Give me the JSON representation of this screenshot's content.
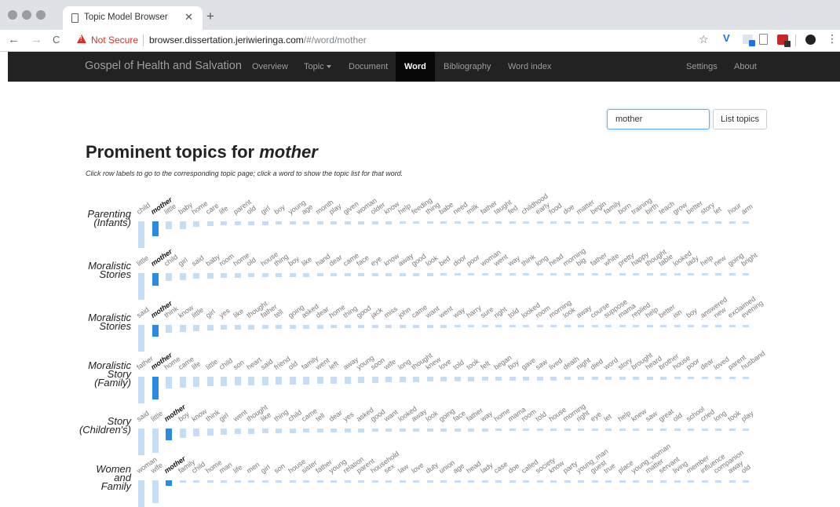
{
  "browser": {
    "tab_title": "Topic Model Browser",
    "close_glyph": "✕",
    "newtab_glyph": "+",
    "back_glyph": "←",
    "forward_glyph": "→",
    "reload_glyph": "C",
    "security_label": "Not Secure",
    "url_host": "browser.dissertation.jeriwieringa.com",
    "url_path": "/#/word/mother",
    "star_glyph": "☆",
    "menu_glyph": "⋮"
  },
  "navbar": {
    "brand": "Gospel of Health and Salvation",
    "items": [
      "Overview",
      "Topic",
      "Document",
      "Word",
      "Bibliography",
      "Word index"
    ],
    "active": "Word",
    "right_items": [
      "Settings",
      "About"
    ]
  },
  "search": {
    "value": "mother",
    "button_label": "List topics"
  },
  "heading": {
    "prefix": "Prominent topics for ",
    "word": "mother"
  },
  "help_text": "Click row labels to go to the corresponding topic page; click a word to show the topic list for that word.",
  "colors": {
    "navbar_bg": "#222222",
    "bar_highlight": "#2b8ae2",
    "bar_normal": "#c6def5"
  },
  "highlight_word": "mother",
  "rows": [
    {
      "label_lines": [
        "Parenting",
        "(Infants)"
      ],
      "words": [
        "child",
        "mother",
        "little",
        "baby",
        "home",
        "care",
        "life",
        "parent",
        "old",
        "girl",
        "boy",
        "young",
        "age",
        "month",
        "play",
        "given",
        "woman",
        "older",
        "know",
        "help",
        "feeding",
        "thing",
        "babe",
        "need",
        "milk",
        "father",
        "taught",
        "fed",
        "childhood",
        "early",
        "food",
        "doe",
        "matter",
        "begin",
        "family",
        "born",
        "training",
        "birth",
        "teach",
        "grow",
        "better",
        "story",
        "let",
        "hour",
        "arm"
      ],
      "weights": [
        1.0,
        0.55,
        0.3,
        0.28,
        0.2,
        0.17,
        0.16,
        0.15,
        0.14,
        0.14,
        0.13,
        0.13,
        0.12,
        0.12,
        0.12,
        0.11,
        0.11,
        0.11,
        0.11,
        0.1,
        0.1,
        0.1,
        0.1,
        0.1,
        0.1,
        0.1,
        0.1,
        0.1,
        0.1,
        0.1,
        0.1,
        0.1,
        0.1,
        0.1,
        0.1,
        0.1,
        0.1,
        0.1,
        0.1,
        0.1,
        0.1,
        0.1,
        0.1,
        0.1,
        0.1
      ]
    },
    {
      "label_lines": [
        "Moralistic",
        "Stories"
      ],
      "words": [
        "little",
        "mother",
        "child",
        "girl",
        "said",
        "baby",
        "room",
        "home",
        "old",
        "house",
        "thing",
        "boy",
        "like",
        "hand",
        "dear",
        "came",
        "face",
        "eye",
        "know",
        "away",
        "good",
        "look",
        "bed",
        "door",
        "poor",
        "woman",
        "went",
        "way",
        "think",
        "long",
        "head",
        "morning",
        "big",
        "father",
        "white",
        "pretty",
        "happy",
        "thought",
        "table",
        "looked",
        "lady",
        "help",
        "new",
        "going",
        "bright"
      ],
      "weights": [
        1.0,
        0.48,
        0.3,
        0.25,
        0.22,
        0.2,
        0.18,
        0.17,
        0.16,
        0.15,
        0.15,
        0.14,
        0.14,
        0.13,
        0.13,
        0.12,
        0.12,
        0.12,
        0.11,
        0.11,
        0.11,
        0.11,
        0.1,
        0.1,
        0.1,
        0.1,
        0.1,
        0.1,
        0.1,
        0.1,
        0.1,
        0.1,
        0.1,
        0.1,
        0.1,
        0.1,
        0.1,
        0.1,
        0.1,
        0.1,
        0.1,
        0.1,
        0.1,
        0.1,
        0.1
      ]
    },
    {
      "label_lines": [
        "Moralistic",
        "Stories"
      ],
      "words": [
        "said",
        "mother",
        "think",
        "know",
        "little",
        "girl",
        "yes",
        "like",
        "thought",
        "father",
        "tell",
        "going",
        "asked",
        "dear",
        "home",
        "thing",
        "good",
        "jack",
        "miss",
        "john",
        "came",
        "want",
        "went",
        "way",
        "harry",
        "sure",
        "right",
        "told",
        "looked",
        "room",
        "morning",
        "look",
        "away",
        "course",
        "suppose",
        "mama",
        "replied",
        "help",
        "better",
        "isn",
        "boy",
        "answered",
        "new",
        "exclaimed",
        "evening"
      ],
      "weights": [
        1.0,
        0.45,
        0.3,
        0.26,
        0.23,
        0.21,
        0.19,
        0.18,
        0.17,
        0.16,
        0.15,
        0.15,
        0.14,
        0.14,
        0.13,
        0.13,
        0.12,
        0.12,
        0.12,
        0.11,
        0.11,
        0.11,
        0.11,
        0.1,
        0.1,
        0.1,
        0.1,
        0.1,
        0.1,
        0.1,
        0.1,
        0.1,
        0.1,
        0.1,
        0.1,
        0.1,
        0.1,
        0.1,
        0.1,
        0.1,
        0.1,
        0.1,
        0.1,
        0.1,
        0.1
      ]
    },
    {
      "label_lines": [
        "Moralistic",
        "Story",
        "(Family)"
      ],
      "words": [
        "father",
        "mother",
        "home",
        "came",
        "life",
        "little",
        "child",
        "son",
        "heart",
        "said",
        "friend",
        "old",
        "family",
        "went",
        "left",
        "away",
        "young",
        "soon",
        "wife",
        "long",
        "thought",
        "knew",
        "love",
        "told",
        "took",
        "felt",
        "began",
        "boy",
        "gave",
        "saw",
        "lived",
        "death",
        "night",
        "died",
        "word",
        "story",
        "brought",
        "heard",
        "brother",
        "house",
        "poor",
        "dear",
        "loved",
        "parent",
        "husband"
      ],
      "weights": [
        1.0,
        0.85,
        0.45,
        0.4,
        0.38,
        0.36,
        0.34,
        0.33,
        0.32,
        0.31,
        0.3,
        0.29,
        0.28,
        0.27,
        0.26,
        0.25,
        0.24,
        0.23,
        0.22,
        0.21,
        0.2,
        0.19,
        0.19,
        0.18,
        0.17,
        0.16,
        0.16,
        0.15,
        0.15,
        0.14,
        0.14,
        0.13,
        0.13,
        0.12,
        0.12,
        0.12,
        0.11,
        0.11,
        0.11,
        0.1,
        0.1,
        0.1,
        0.1,
        0.1,
        0.1
      ]
    },
    {
      "label_lines": [
        "Story",
        "(Children's)"
      ],
      "words": [
        "said",
        "little",
        "mother",
        "boy",
        "know",
        "think",
        "girl",
        "went",
        "thought",
        "like",
        "thing",
        "child",
        "came",
        "tell",
        "dear",
        "yes",
        "asked",
        "good",
        "want",
        "looked",
        "away",
        "look",
        "going",
        "face",
        "father",
        "way",
        "home",
        "mama",
        "room",
        "told",
        "house",
        "morning",
        "right",
        "eye",
        "let",
        "help",
        "knew",
        "saw",
        "great",
        "old",
        "school",
        "cried",
        "long",
        "took",
        "play"
      ],
      "weights": [
        1.0,
        0.9,
        0.45,
        0.35,
        0.3,
        0.26,
        0.24,
        0.22,
        0.2,
        0.19,
        0.18,
        0.17,
        0.16,
        0.15,
        0.15,
        0.14,
        0.14,
        0.13,
        0.13,
        0.12,
        0.12,
        0.12,
        0.11,
        0.11,
        0.11,
        0.11,
        0.1,
        0.1,
        0.1,
        0.1,
        0.1,
        0.1,
        0.1,
        0.1,
        0.1,
        0.1,
        0.1,
        0.1,
        0.1,
        0.1,
        0.1,
        0.1,
        0.1,
        0.1,
        0.1
      ]
    },
    {
      "label_lines": [
        "Women",
        "and",
        "Family"
      ],
      "words": [
        "woman",
        "wife",
        "mother",
        "family",
        "child",
        "home",
        "man",
        "life",
        "men",
        "girl",
        "son",
        "house",
        "sister",
        "father",
        "young",
        "relation",
        "parent",
        "household",
        "sex",
        "law",
        "love",
        "duty",
        "union",
        "age",
        "head",
        "lady",
        "case",
        "doe",
        "called",
        "society",
        "know",
        "party",
        "young_man",
        "guest",
        "true",
        "place",
        "young_woman",
        "matter",
        "servant",
        "living",
        "member",
        "influence",
        "companion",
        "away",
        "old"
      ],
      "weights": [
        1.0,
        0.85,
        0.2,
        0.1,
        0.1,
        0.1,
        0.1,
        0.1,
        0.1,
        0.1,
        0.1,
        0.1,
        0.1,
        0.1,
        0.1,
        0.1,
        0.1,
        0.1,
        0.1,
        0.1,
        0.1,
        0.1,
        0.1,
        0.1,
        0.1,
        0.1,
        0.1,
        0.1,
        0.1,
        0.1,
        0.1,
        0.1,
        0.1,
        0.1,
        0.1,
        0.1,
        0.1,
        0.1,
        0.1,
        0.1,
        0.1,
        0.1,
        0.1,
        0.1,
        0.1
      ]
    }
  ]
}
